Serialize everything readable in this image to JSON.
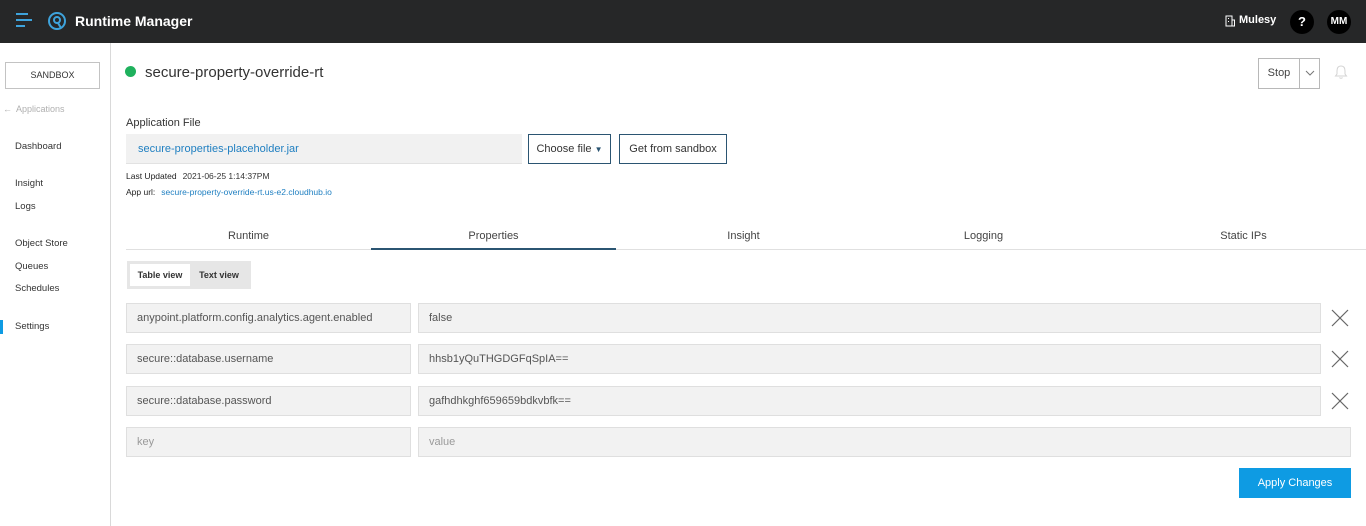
{
  "topbar": {
    "app_title": "Runtime Manager",
    "org_name": "Mulesy",
    "help_label": "?",
    "user_initials": "MM"
  },
  "sidebar": {
    "environment": "SANDBOX",
    "back_label": "Applications",
    "items": [
      {
        "label": "Dashboard"
      },
      {
        "label": "Insight"
      },
      {
        "label": "Logs"
      },
      {
        "label": "Object Store"
      },
      {
        "label": "Queues"
      },
      {
        "label": "Schedules"
      },
      {
        "label": "Settings",
        "active": true
      }
    ]
  },
  "header": {
    "app_name": "secure-property-override-rt",
    "status_color": "#1fb15d",
    "stop_label": "Stop"
  },
  "application_file": {
    "label": "Application File",
    "filename": "secure-properties-placeholder.jar",
    "choose_file_label": "Choose file",
    "get_from_sandbox_label": "Get from sandbox",
    "last_updated_label": "Last Updated",
    "last_updated_value": "2021-06-25 1:14:37PM",
    "app_url_label": "App url:",
    "app_url_value": "secure-property-override-rt.us-e2.cloudhub.io"
  },
  "tabs": [
    {
      "label": "Runtime"
    },
    {
      "label": "Properties",
      "active": true
    },
    {
      "label": "Insight"
    },
    {
      "label": "Logging"
    },
    {
      "label": "Static IPs"
    }
  ],
  "view_toggle": {
    "table_view": "Table view",
    "text_view": "Text view",
    "selected": "Table view"
  },
  "properties": [
    {
      "key": "anypoint.platform.config.analytics.agent.enabled",
      "value": "false"
    },
    {
      "key": "secure::database.username",
      "value": "hhsb1yQuTHGDGFqSpIA=="
    },
    {
      "key": "secure::database.password",
      "value": "gafhdhkghf659659bdkvbfk=="
    }
  ],
  "new_property": {
    "key_placeholder": "key",
    "value_placeholder": "value"
  },
  "apply_label": "Apply Changes",
  "colors": {
    "accent": "#0e9be3",
    "topbar": "#262728",
    "link": "#1f7fc1"
  }
}
